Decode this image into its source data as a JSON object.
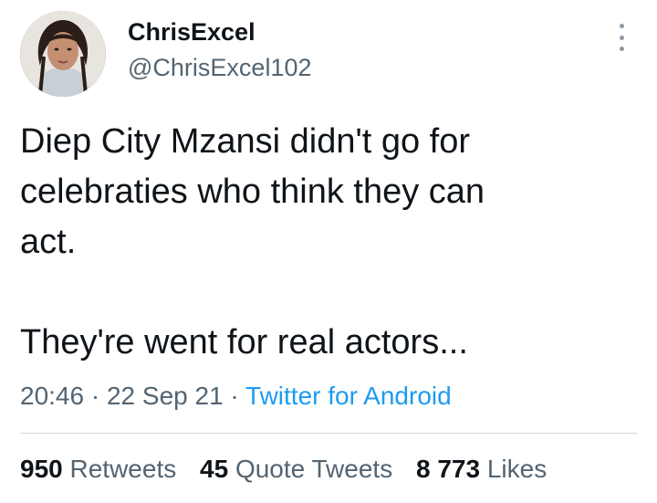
{
  "tweet": {
    "display_name": "ChrisExcel",
    "handle": "@ChrisExcel102",
    "text": "Diep City Mzansi didn't go for\ncelebraties who think they can\nact.\n\nThey're went for real actors...",
    "time": "20:46",
    "date": "22 Sep 21",
    "source": "Twitter for Android",
    "separator": "·"
  },
  "stats": {
    "retweets_count": "950",
    "retweets_label": "Retweets",
    "quote_count": "45",
    "quote_label": "Quote Tweets",
    "likes_count": "8 773",
    "likes_label": "Likes"
  },
  "icons": {
    "more": "more-vertical-icon"
  },
  "colors": {
    "text": "#0f1419",
    "secondary": "#536471",
    "link": "#1d9bf0",
    "divider": "#cfd9de"
  }
}
